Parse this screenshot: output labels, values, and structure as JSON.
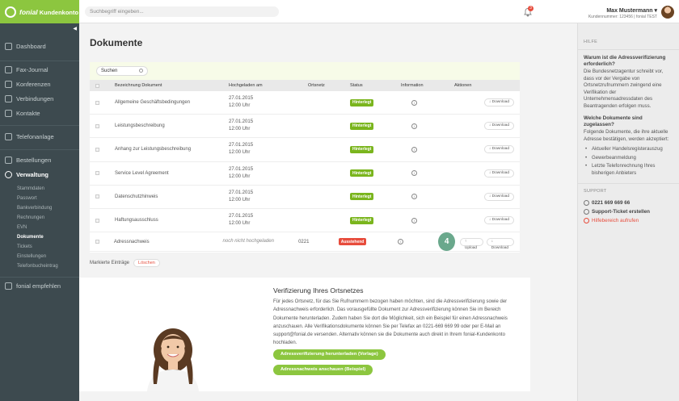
{
  "header": {
    "logo_brand": "fonial",
    "logo_label": "Kundenkonto",
    "search_placeholder": "Suchbegriff eingeben...",
    "notification_count": "3",
    "user_name": "Max Mustermann",
    "user_sub": "Kundennummer: 123456 | fonial TEST"
  },
  "sidebar": {
    "items": [
      {
        "label": "Dashboard",
        "icon": "dashboard-icon"
      },
      {
        "label": "Fax-Journal",
        "icon": "fax-icon"
      },
      {
        "label": "Konferenzen",
        "icon": "conference-icon"
      },
      {
        "label": "Verbindungen",
        "icon": "connections-icon"
      },
      {
        "label": "Kontakte",
        "icon": "contacts-icon"
      },
      {
        "label": "Telefonanlage",
        "icon": "phone-system-icon"
      },
      {
        "label": "Bestellungen",
        "icon": "cart-icon"
      },
      {
        "label": "Verwaltung",
        "icon": "admin-icon"
      },
      {
        "label": "fonial empfehlen",
        "icon": "recommend-icon"
      }
    ],
    "subitems": [
      "Stammdaten",
      "Passwort",
      "Bankverbindung",
      "Rechnungen",
      "EVN",
      "Dokumente",
      "Tickets",
      "Einstellungen",
      "Telefonbucheintrag"
    ]
  },
  "main": {
    "title": "Dokumente",
    "filter_placeholder": "Suchen",
    "columns": [
      "Bezeichnung Dokument",
      "Hochgeladen am",
      "Ortsnetz",
      "Status",
      "Information",
      "Aktionen"
    ],
    "rows": [
      {
        "name": "Allgemeine Geschäftsbedingungen",
        "date": "27.01.2015",
        "time": "12:00 Uhr",
        "net": "",
        "status": "Hinterlegt"
      },
      {
        "name": "Leistungsbeschreibung",
        "date": "27.01.2015",
        "time": "12:00 Uhr",
        "net": "",
        "status": "Hinterlegt"
      },
      {
        "name": "Anhang zur Leistungsbeschreibung",
        "date": "27.01.2015",
        "time": "12:00 Uhr",
        "net": "",
        "status": "Hinterlegt"
      },
      {
        "name": "Service Level Agreement",
        "date": "27.01.2015",
        "time": "12:00 Uhr",
        "net": "",
        "status": "Hinterlegt"
      },
      {
        "name": "Datenschutzhinweis",
        "date": "27.01.2015",
        "time": "12:00 Uhr",
        "net": "",
        "status": "Hinterlegt"
      },
      {
        "name": "Haftungsausschluss",
        "date": "27.01.2015",
        "time": "12:00 Uhr",
        "net": "",
        "status": "Hinterlegt"
      },
      {
        "name": "Adressnachweis",
        "date": "noch nicht hochgeladen",
        "time": "",
        "net": "0221",
        "status": "Ausstehend"
      }
    ],
    "download_label": "Download",
    "upload_label": "Upload",
    "step_number": "4",
    "marked_label": "Markierte Einträge",
    "delete_label": "Löschen"
  },
  "verify": {
    "title": "Verifizierung Ihres Ortsnetzes",
    "text": "Für jedes Ortsnetz, für das Sie Rufnummern bezogen haben möchten, sind die Adressverifizierung sowie der Adressnachweis erforderlich. Das vorausgefüllte Dokument zur Adressverifizierung können Sie im Bereich Dokumente herunterladen. Zudem haben Sie dort die Möglichkeit, sich ein Beispiel für einen Adressnachweis anzuschauen. Alle Verifikationsdokumente können Sie per Telefax an 0221-669 669 99 oder per E-Mail an support@fonial.de versenden. Alternativ können sie die Dokumente auch direkt in Ihrem fonial-Kundenkonto hochladen.",
    "btn_download": "Adressverifizierung herunterladen (Vorlage)",
    "btn_example": "Adressnachweis anschauen (Beispiel)"
  },
  "help": {
    "heading": "HILFE",
    "q1": "Warum ist die Adressverifizierung erforderlich?",
    "a1": "Die Bundesnetzagentur schreibt vor, dass vor der Vergabe von Ortsnetzrufnummern zwingend eine Verifikation der Unternehmensadressdaten des Beantragenden erfolgen muss.",
    "q2": "Welche Dokumente sind zugelassen?",
    "a2": "Folgende Dokumente, die ihre aktuelle Adresse bestätigen, werden akzeptiert:",
    "list": [
      "Aktueller Handelsregisterauszug",
      "Gewerbeanmeldung",
      "Letzte Telefonrechnung Ihres bisherigen Anbieters"
    ],
    "support_heading": "SUPPORT",
    "phone": "0221 669 669 66",
    "ticket": "Support-Ticket erstellen",
    "helpcenter": "Hilfebereich aufrufen"
  }
}
